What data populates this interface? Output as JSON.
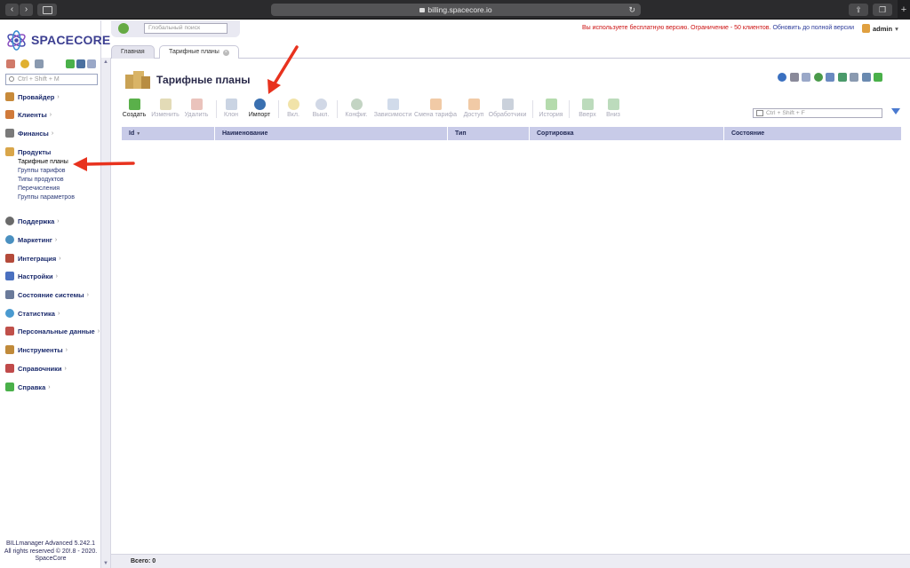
{
  "browser": {
    "url": "billing.spacecore.io",
    "plus_label": "+"
  },
  "app": {
    "logo_text": "SPACECORE"
  },
  "sidebar": {
    "search_placeholder": "Ctrl + Shift + M",
    "menu": [
      {
        "label": "Провайдер",
        "icon": "provider-icon",
        "color": "#c78a3a"
      },
      {
        "label": "Клиенты",
        "icon": "clients-icon",
        "color": "#d07a3a"
      },
      {
        "label": "Финансы",
        "icon": "finance-icon",
        "color": "#7a7a7a"
      },
      {
        "label": "Продукты",
        "icon": "products-icon",
        "color": "#d9a64a"
      },
      {
        "label": "Поддержка",
        "icon": "support-icon",
        "color": "#6a6a6a"
      },
      {
        "label": "Маркетинг",
        "icon": "marketing-icon",
        "color": "#4a90c0"
      },
      {
        "label": "Интеграция",
        "icon": "integration-icon",
        "color": "#b44a3a"
      },
      {
        "label": "Настройки",
        "icon": "settings-icon",
        "color": "#4a70c0"
      },
      {
        "label": "Состояние системы",
        "icon": "system-status-icon",
        "color": "#6a7a9a"
      },
      {
        "label": "Статистика",
        "icon": "statistics-icon",
        "color": "#4a9ad0"
      },
      {
        "label": "Персональные данные",
        "icon": "personal-data-icon",
        "color": "#c0504a"
      },
      {
        "label": "Инструменты",
        "icon": "tools-icon",
        "color": "#c08a3a"
      },
      {
        "label": "Справочники",
        "icon": "references-icon",
        "color": "#c04a4a"
      },
      {
        "label": "Справка",
        "icon": "help-icon",
        "color": "#4ab04a"
      }
    ],
    "submenu": [
      {
        "label": "Тарифные планы",
        "active": true
      },
      {
        "label": "Группы тарифов"
      },
      {
        "label": "Типы продуктов"
      },
      {
        "label": "Перечисления"
      },
      {
        "label": "Группы параметров"
      }
    ],
    "footer": {
      "version": "BILLmanager Advanced 5.242.1",
      "rights": "All rights reserved © 20!.8 - 2020.",
      "company": "SpaceCore"
    }
  },
  "header": {
    "global_search_placeholder": "Глобальный поиск",
    "warning": "Вы используете бесплатную версию. Ограничение - 50 клиентов.",
    "upgrade_link": "Обновить до полной версии",
    "user": "admin"
  },
  "tabs": [
    {
      "label": "Главная"
    },
    {
      "label": "Тарифные планы",
      "active": true
    }
  ],
  "page": {
    "title": "Тарифные планы",
    "filter_placeholder": "Ctrl + Shift + F"
  },
  "toolbar": [
    {
      "label": "Создать",
      "icon": "create-icon",
      "enabled": true,
      "color": "#5ab04a"
    },
    {
      "label": "Изменить",
      "icon": "edit-icon",
      "enabled": false,
      "color": "#c0b060"
    },
    {
      "label": "Удалить",
      "icon": "delete-icon",
      "enabled": false,
      "color": "#d07a6a"
    },
    {
      "label": "Клон",
      "icon": "clone-icon",
      "enabled": false,
      "color": "#8aa0c0"
    },
    {
      "label": "Импорт",
      "icon": "import-icon",
      "enabled": true,
      "color": "#3a70b0"
    },
    {
      "label": "Вкл.",
      "icon": "enable-icon",
      "enabled": false,
      "color": "#e0c040"
    },
    {
      "label": "Выкл.",
      "icon": "disable-icon",
      "enabled": false,
      "color": "#9aa8c8"
    },
    {
      "label": "Конфиг.",
      "icon": "config-icon",
      "enabled": false,
      "color": "#7aa07a"
    },
    {
      "label": "Зависимости",
      "icon": "dependencies-icon",
      "enabled": false,
      "color": "#9ab0d0"
    },
    {
      "label": "Смена тарифа",
      "icon": "change-tariff-icon",
      "enabled": false,
      "color": "#e08a3a"
    },
    {
      "label": "Доступ",
      "icon": "access-icon",
      "enabled": false,
      "color": "#e08a3a"
    },
    {
      "label": "Обработчики",
      "icon": "handlers-icon",
      "enabled": false,
      "color": "#8a9ab0"
    },
    {
      "label": "История",
      "icon": "history-icon",
      "enabled": false,
      "color": "#5ab04a"
    },
    {
      "label": "Вверх",
      "icon": "up-icon",
      "enabled": false,
      "color": "#6ab06a"
    },
    {
      "label": "Вниз",
      "icon": "down-icon",
      "enabled": false,
      "color": "#6ab06a"
    }
  ],
  "grid": {
    "columns": [
      "Id",
      "Наименование",
      "Тип",
      "Сортировка",
      "Состояние"
    ],
    "sort_indicator": "▼"
  },
  "status": {
    "total": "Всего: 0"
  },
  "colors": {
    "accent": "#3c3f91",
    "grid_header": "#c8cbe8",
    "warning": "#cc1111",
    "annotation_arrow": "#e8321e"
  }
}
